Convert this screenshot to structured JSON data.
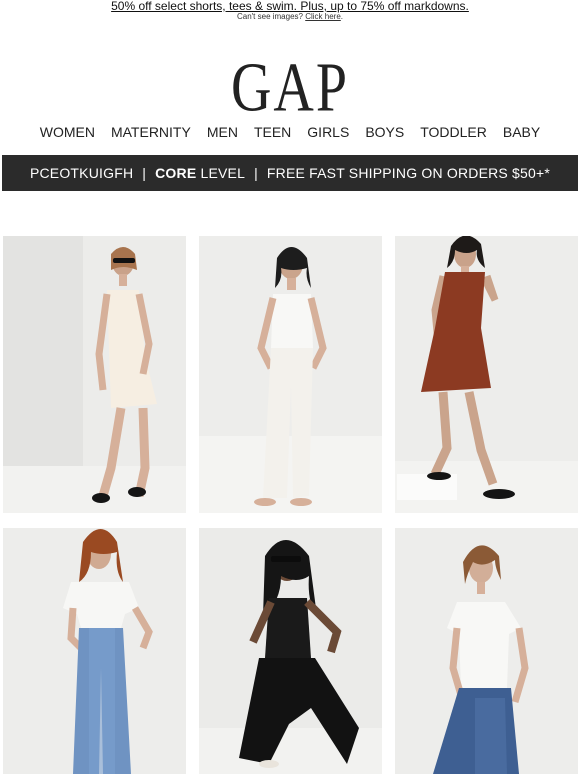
{
  "preheader": {
    "promo_link": "50% off select shorts, tees & swim. Plus, up to 75% off markdowns.",
    "images_prompt": "Can't see images?",
    "click_here": "Click here"
  },
  "brand": {
    "logo_text": "GAP"
  },
  "nav": {
    "items": [
      "WOMEN",
      "MATERNITY",
      "MEN",
      "TEEN",
      "GIRLS",
      "BOYS",
      "TODDLER",
      "BABY"
    ]
  },
  "banner": {
    "member_id": "PCEOTKUIGFH",
    "separator": "|",
    "level_bold": "CORE",
    "level_suffix": " LEVEL",
    "shipping": "FREE FAST SHIPPING ON ORDERS $50+*"
  },
  "products": [
    {
      "icon": "white-mini-dress-image"
    },
    {
      "icon": "white-tank-and-jeans-image"
    },
    {
      "icon": "rust-mini-dress-image"
    },
    {
      "icon": "white-tee-and-wide-jeans-image"
    },
    {
      "icon": "black-tank-and-pants-image"
    },
    {
      "icon": "white-tee-and-blue-jeans-image"
    }
  ],
  "colors": {
    "banner_bg": "#2b2b2b",
    "banner_text": "#ffffff"
  }
}
